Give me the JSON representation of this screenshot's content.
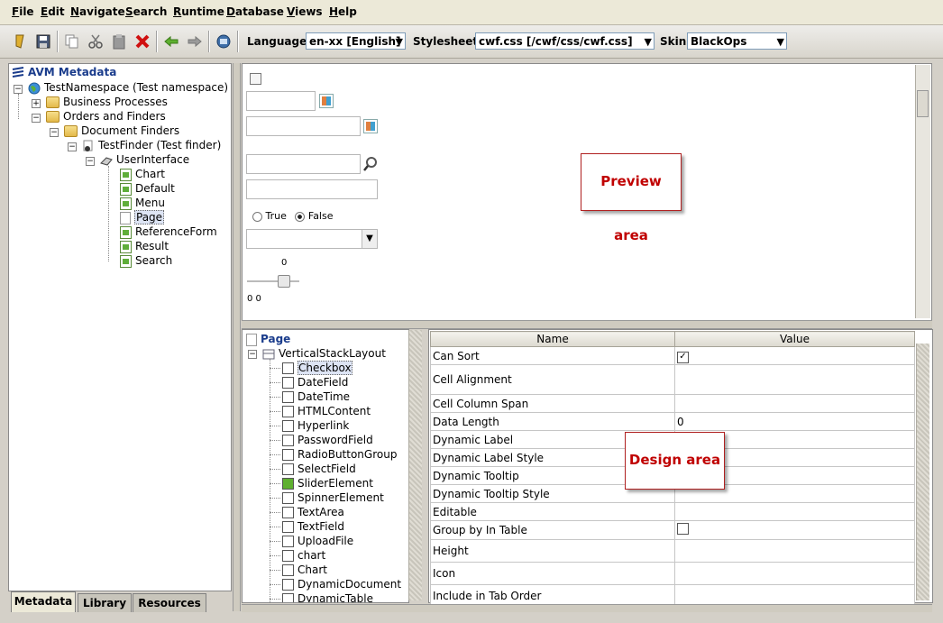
{
  "menubar": {
    "items": [
      "File",
      "Edit",
      "Navigate",
      "Search",
      "Runtime",
      "Database",
      "Views",
      "Help"
    ]
  },
  "toolbar": {
    "language_label": "Language:",
    "language_value": "en-xx [English]",
    "stylesheet_label": "Stylesheet:",
    "stylesheet_value": "cwf.css [/cwf/css/cwf.css]",
    "skin_label": "Skin:",
    "skin_value": "BlackOps"
  },
  "metadata_tree": {
    "root": "AVM Metadata",
    "namespace": "TestNamespace (Test namespace)",
    "business_processes": "Business Processes",
    "orders_and_finders": "Orders and Finders",
    "document_finders": "Document Finders",
    "test_finder": "TestFinder (Test finder)",
    "user_interface": "UserInterface",
    "children": [
      "Chart",
      "Default",
      "Menu",
      "Page",
      "ReferenceForm",
      "Result",
      "Search"
    ]
  },
  "bottom_tabs": [
    "Metadata",
    "Library",
    "Resources"
  ],
  "preview": {
    "callout": "Preview area",
    "radio_true": "True",
    "radio_false": "False",
    "slider_value": "0",
    "slider_minmax": "0 0"
  },
  "component_tree": {
    "root": "Page",
    "layout": "VerticalStackLayout",
    "items": [
      "Checkbox",
      "DateField",
      "DateTime",
      "HTMLContent",
      "Hyperlink",
      "PasswordField",
      "RadioButtonGroup",
      "SelectField",
      "SliderElement",
      "SpinnerElement",
      "TextArea",
      "TextField",
      "UploadFile",
      "chart",
      "Chart",
      "DynamicDocument",
      "DynamicTable"
    ]
  },
  "property_grid": {
    "headers": [
      "Name",
      "Value"
    ],
    "rows": [
      {
        "name": "Can Sort",
        "value": "checked"
      },
      {
        "name": "Cell Alignment",
        "value": ""
      },
      {
        "name": "Cell Column Span",
        "value": ""
      },
      {
        "name": "Data Length",
        "value": "0"
      },
      {
        "name": "Dynamic Label",
        "value": ""
      },
      {
        "name": "Dynamic Label Style",
        "value": ""
      },
      {
        "name": "Dynamic Tooltip",
        "value": ""
      },
      {
        "name": "Dynamic Tooltip Style",
        "value": ""
      },
      {
        "name": "Editable",
        "value": ""
      },
      {
        "name": "Group by In Table",
        "value": "unchecked"
      },
      {
        "name": "Height",
        "value": ""
      },
      {
        "name": "Icon",
        "value": ""
      },
      {
        "name": "Include in Tab Order",
        "value": ""
      }
    ],
    "callout": "Design area"
  }
}
